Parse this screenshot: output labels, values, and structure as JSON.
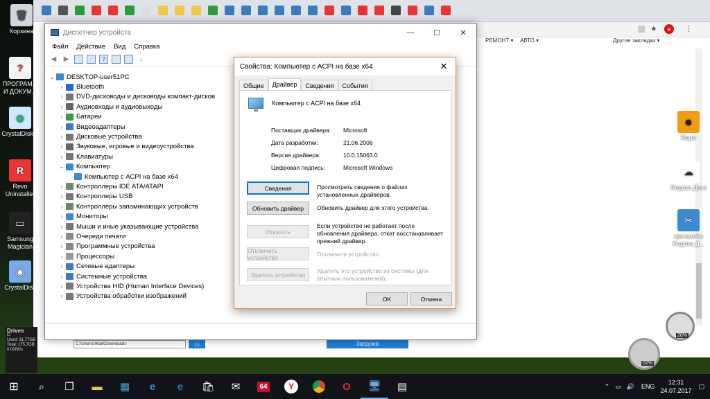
{
  "desktop": {
    "icons": [
      {
        "label": "Корзина"
      },
      {
        "label": "ПРОГРАМ... И ДОКУМ..."
      },
      {
        "label": "CrystalDisk 5"
      },
      {
        "label": "Revo Uninstaller"
      },
      {
        "label": "Samsung Magician"
      },
      {
        "label": "CrystalDisk"
      }
    ],
    "right_icons": [
      {
        "label": "Raptr"
      },
      {
        "label": "Яндекс.Диск"
      },
      {
        "label": "криншоты Яндекс.Д..."
      }
    ]
  },
  "browser": {
    "bookmarks": {
      "remont": "РЕМОНТ ▾",
      "avto": "АВТО ▾",
      "other": "Другие закладки ▾"
    }
  },
  "device_manager": {
    "title": "Диспетчер устройств",
    "menu": [
      "Файл",
      "Действие",
      "Вид",
      "Справка"
    ],
    "root": "DESKTOP-user51PC",
    "items": [
      {
        "label": "Bluetooth",
        "color": "#1e6fd9"
      },
      {
        "label": "DVD-дисководы и дисководы компакт-дисков",
        "color": "#777777"
      },
      {
        "label": "Аудиовходы и аудиовыходы",
        "color": "#666666"
      },
      {
        "label": "Батареи",
        "color": "#3a9d3a"
      },
      {
        "label": "Видеоадаптеры",
        "color": "#3b7bbf"
      },
      {
        "label": "Дисковые устройства",
        "color": "#777777"
      },
      {
        "label": "Звуковые, игровые и видеоустройства",
        "color": "#666666"
      },
      {
        "label": "Клавиатуры",
        "color": "#777777"
      },
      {
        "label": "Компьютер",
        "color": "#3b8bd1",
        "expanded": true
      },
      {
        "label": "Компьютер с ACPI на базе x64",
        "color": "#3b8bd1",
        "child": true
      },
      {
        "label": "Контроллеры IDE ATA/ATAPI",
        "color": "#6a8a6a"
      },
      {
        "label": "Контроллеры USB",
        "color": "#777777"
      },
      {
        "label": "Контроллеры запоминающих устройств",
        "color": "#6a8a6a"
      },
      {
        "label": "Мониторы",
        "color": "#3b8bd1"
      },
      {
        "label": "Мыши и иные указывающие устройства",
        "color": "#777777"
      },
      {
        "label": "Очереди печати",
        "color": "#888888"
      },
      {
        "label": "Программные устройства",
        "color": "#888888"
      },
      {
        "label": "Процессоры",
        "color": "#999999"
      },
      {
        "label": "Сетевые адаптеры",
        "color": "#3b7bbf"
      },
      {
        "label": "Системные устройства",
        "color": "#3b7bbf"
      },
      {
        "label": "Устройства HID (Human Interface Devices)",
        "color": "#777777"
      },
      {
        "label": "Устройства обработки изображений",
        "color": "#777777"
      }
    ]
  },
  "dialog": {
    "title": "Свойства: Компьютер с ACPI на базе x64",
    "tabs": [
      "Общие",
      "Драйвер",
      "Сведения",
      "События"
    ],
    "device_name": "Компьютер с ACPI на базе x64",
    "props": [
      {
        "k": "Поставщик драйвера:",
        "v": "Microsoft"
      },
      {
        "k": "Дата разработки:",
        "v": "21.06.2006"
      },
      {
        "k": "Версия драйвера:",
        "v": "10.0.15063.0"
      },
      {
        "k": "Цифровая подпись:",
        "v": "Microsoft Windows"
      }
    ],
    "actions": [
      {
        "label": "Сведения",
        "desc": "Просмотреть сведения о файлах установленных драйверов."
      },
      {
        "label": "Обновить драйвер",
        "desc": "Обновить драйвер для этого устройства."
      },
      {
        "label": "Откатить",
        "desc": "Если устройство не работает после обновления драйвера, откат восстанавливает прежний драйвер."
      },
      {
        "label": "Отключить устройство",
        "desc": "Отключите устройство."
      },
      {
        "label": "Удалить устройство",
        "desc": "Удалить это устройство из системы (для опытных пользователей)."
      }
    ],
    "ok": "OK",
    "cancel": "Отмена"
  },
  "download_strip": {
    "path": "C:\\Users\\Жак\\Downloads",
    "download": "Загрузка"
  },
  "drives_widget": {
    "title": "Drives",
    "line1": "C:",
    "line2": "Used: 31.77GB",
    "line3": "Total: 175.7GB",
    "line4": "0.0008/s"
  },
  "gauges": {
    "upper": "20%",
    "lower": "02%"
  },
  "taskbar": {
    "lang": "ENG",
    "time": "12:31",
    "date": "24.07.2017",
    "pinned": [
      "64"
    ]
  }
}
